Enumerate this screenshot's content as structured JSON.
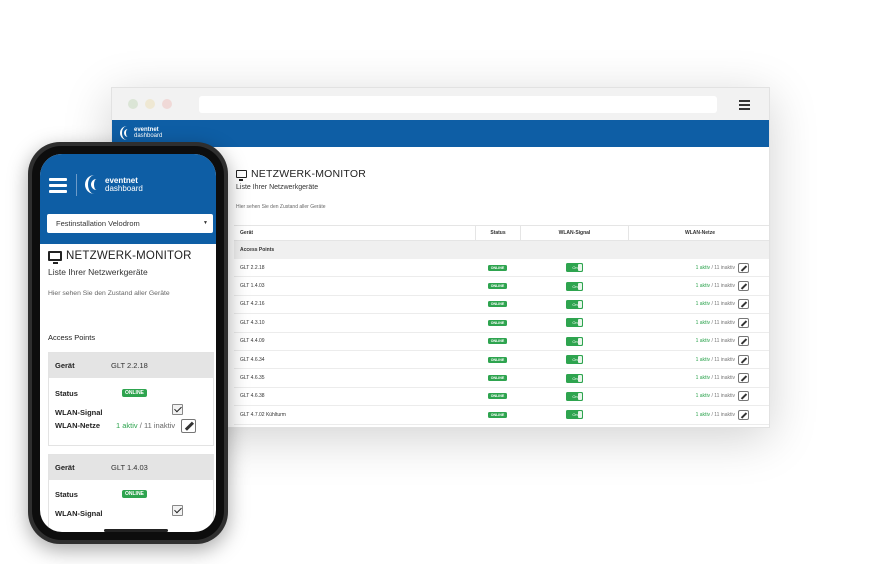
{
  "brand": {
    "name": "eventnet",
    "sub": "dashboard"
  },
  "page": {
    "title": "NETZWERK-MONITOR",
    "subtitle": "Liste Ihrer Netzwerkgeräte",
    "description": "Hier sehen Sie den Zustand aller Geräte"
  },
  "mobile": {
    "location_select": "Festinstallation Velodrom",
    "group_label": "Access Points",
    "labels": {
      "device": "Gerät",
      "status": "Status",
      "wlan_signal": "WLAN-Signal",
      "wlan_networks": "WLAN-Netze"
    },
    "devices": [
      {
        "name": "GLT 2.2.18",
        "status": "ONLINE",
        "net_active": "1 aktiv",
        "net_sep": " / ",
        "net_inactive": "11 inaktiv"
      },
      {
        "name": "GLT 1.4.03",
        "status": "ONLINE"
      }
    ]
  },
  "desktop": {
    "columns": [
      "Gerät",
      "Status",
      "WLAN-Signal",
      "WLAN-Netze"
    ],
    "group_label": "Access Points",
    "rows": [
      {
        "device": "GLT 2.2.18",
        "status": "ONLINE",
        "signal": "On",
        "active": "1 aktiv",
        "inactive": "11 inaktiv"
      },
      {
        "device": "GLT 1.4.03",
        "status": "ONLINE",
        "signal": "On",
        "active": "1 aktiv",
        "inactive": "11 inaktiv"
      },
      {
        "device": "GLT 4.2.16",
        "status": "ONLINE",
        "signal": "On",
        "active": "1 aktiv",
        "inactive": "11 inaktiv"
      },
      {
        "device": "GLT 4.3.10",
        "status": "ONLINE",
        "signal": "On",
        "active": "1 aktiv",
        "inactive": "11 inaktiv"
      },
      {
        "device": "GLT 4.4.09",
        "status": "ONLINE",
        "signal": "On",
        "active": "1 aktiv",
        "inactive": "11 inaktiv"
      },
      {
        "device": "GLT 4.6.34",
        "status": "ONLINE",
        "signal": "On",
        "active": "1 aktiv",
        "inactive": "11 inaktiv"
      },
      {
        "device": "GLT 4.6.35",
        "status": "ONLINE",
        "signal": "On",
        "active": "1 aktiv",
        "inactive": "11 inaktiv"
      },
      {
        "device": "GLT 4.6.38",
        "status": "ONLINE",
        "signal": "On",
        "active": "1 aktiv",
        "inactive": "11 inaktiv"
      },
      {
        "device": "GLT 4.7.02 Kühlturm",
        "status": "ONLINE",
        "signal": "On",
        "active": "1 aktiv",
        "inactive": "11 inaktiv"
      }
    ]
  },
  "colors": {
    "brand_blue": "#0e5ea5",
    "online_green": "#2ea44f"
  },
  "icons": [
    "hamburger-menu-icon",
    "monitor-icon",
    "edit-pencil-icon",
    "checkbox-checked-icon",
    "caret-down-icon"
  ]
}
